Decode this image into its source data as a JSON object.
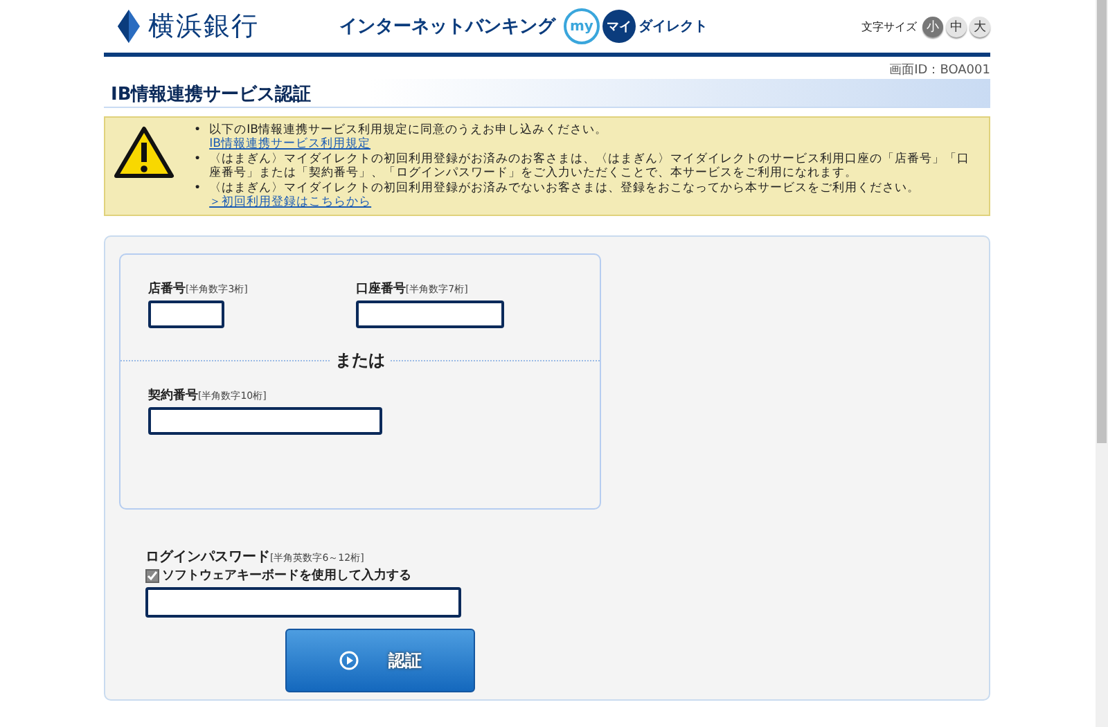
{
  "header": {
    "bank_name": "横浜銀行",
    "service_name": "インターネットバンキング",
    "logo_my": "my",
    "logo_mai": "マイ",
    "logo_direct": "ダイレクト",
    "font_size_label": "文字サイズ",
    "font_sizes": [
      {
        "label": "小",
        "selected": true
      },
      {
        "label": "中",
        "selected": false
      },
      {
        "label": "大",
        "selected": false
      }
    ]
  },
  "screen_id": "画面ID：BOA001",
  "page_title": "IB情報連携サービス認証",
  "notice": {
    "items": [
      {
        "bullet": "•",
        "text": "以下のIB情報連携サービス利用規定に同意のうえお申し込みください。",
        "link": "IB情報連携サービス利用規定"
      },
      {
        "bullet": "•",
        "text": "〈はまぎん〉マイダイレクトの初回利用登録がお済みのお客さまは、〈はまぎん〉マイダイレクトのサービス利用口座の「店番号」「口座番号」または「契約番号」、「ログインパスワード」をご入力いただくことで、本サービスをご利用になれます。"
      },
      {
        "bullet": "•",
        "text": "〈はまぎん〉マイダイレクトの初回利用登録がお済みでないお客さまは、登録をおこなってから本サービスをご利用ください。",
        "link": "＞初回利用登録はこちらから"
      }
    ]
  },
  "form": {
    "branch": {
      "label": "店番号",
      "hint": "[半角数字3桁]"
    },
    "account": {
      "label": "口座番号",
      "hint": "[半角数字7桁]"
    },
    "or_label": "または",
    "contract": {
      "label": "契約番号",
      "hint": "[半角数字10桁]"
    },
    "password": {
      "label": "ログインパスワード",
      "hint": "[半角英数字6～12桁]"
    },
    "software_keyboard": {
      "label": "ソフトウェアキーボードを使用して入力する",
      "checked": true
    },
    "submit": "認証"
  }
}
